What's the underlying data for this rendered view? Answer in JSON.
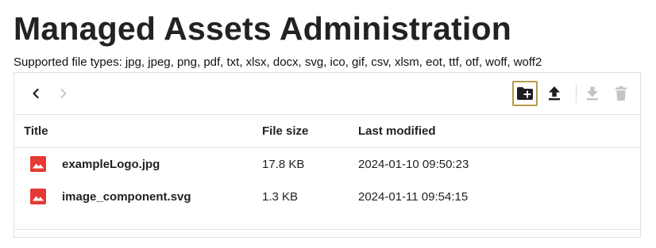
{
  "page": {
    "title": "Managed Assets Administration",
    "supported_types": "Supported file types: jpg, jpeg, png, pdf, txt, xlsx, docx, svg, ico, gif, csv, xlsm, eot, ttf, otf, woff, woff2"
  },
  "toolbar": {
    "back_icon": "chevron-left-icon",
    "forward_icon": "chevron-right-icon",
    "new_folder_icon": "create-new-folder-icon",
    "upload_icon": "upload-icon",
    "download_icon": "download-icon",
    "delete_icon": "trash-icon",
    "forward_enabled": false,
    "download_enabled": false,
    "delete_enabled": false,
    "focused_button": "new-folder",
    "focus_color": "#b49c4a"
  },
  "table": {
    "columns": [
      "Title",
      "File size",
      "Last modified"
    ],
    "rows": [
      {
        "name": "exampleLogo.jpg",
        "size": "17.8 KB",
        "modified": "2024-01-10 09:50:23",
        "icon": "image-icon"
      },
      {
        "name": "image_component.svg",
        "size": "1.3 KB",
        "modified": "2024-01-11 09:54:15",
        "icon": "image-icon"
      }
    ]
  },
  "colors": {
    "file_icon": "#e53935",
    "icon_active": "#1e1e1e",
    "icon_disabled": "#c4c4c4"
  }
}
